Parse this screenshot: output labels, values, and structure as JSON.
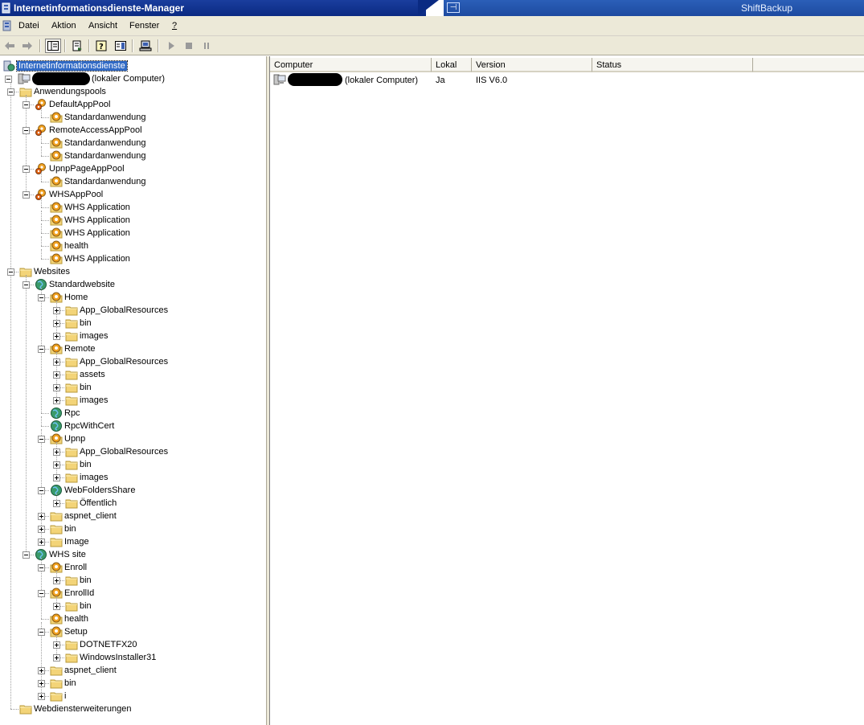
{
  "window": {
    "title": "Internetinformationsdienste-Manager",
    "right_window_title": "ShiftBackup",
    "pin_glyph": "⊣"
  },
  "menu": [
    "Datei",
    "Aktion",
    "Ansicht",
    "Fenster",
    "?"
  ],
  "toolbar": {
    "buttons": [
      "back-arrow-icon",
      "forward-arrow-icon",
      "show-hide-tree-icon",
      "export-list-icon",
      "help-icon",
      "properties-icon",
      "connect-computer-icon",
      "play-icon",
      "stop-icon",
      "pause-icon"
    ]
  },
  "tree": [
    {
      "label": "Internetinformationsdienste",
      "depth": 0,
      "icon": "iis-root-icon",
      "toggle": "none",
      "selected": true
    },
    {
      "label": "(lokaler Computer)",
      "depth": 0,
      "icon": "computer-icon",
      "toggle": "minus",
      "redacted": true
    },
    {
      "label": "Anwendungspools",
      "depth": 1,
      "icon": "folder-icon",
      "toggle": "minus"
    },
    {
      "label": "DefaultAppPool",
      "depth": 2,
      "icon": "app-pool-icon",
      "toggle": "minus"
    },
    {
      "label": "Standardanwendung",
      "depth": 3,
      "icon": "application-icon",
      "toggle": "none"
    },
    {
      "label": "RemoteAccessAppPool",
      "depth": 2,
      "icon": "app-pool-icon",
      "toggle": "minus"
    },
    {
      "label": "Standardanwendung",
      "depth": 3,
      "icon": "application-icon",
      "toggle": "none"
    },
    {
      "label": "Standardanwendung",
      "depth": 3,
      "icon": "application-icon",
      "toggle": "none"
    },
    {
      "label": "UpnpPageAppPool",
      "depth": 2,
      "icon": "app-pool-icon",
      "toggle": "minus"
    },
    {
      "label": "Standardanwendung",
      "depth": 3,
      "icon": "application-icon",
      "toggle": "none"
    },
    {
      "label": "WHSAppPool",
      "depth": 2,
      "icon": "app-pool-icon",
      "toggle": "minus"
    },
    {
      "label": "WHS Application",
      "depth": 3,
      "icon": "application-icon",
      "toggle": "none"
    },
    {
      "label": "WHS Application",
      "depth": 3,
      "icon": "application-icon",
      "toggle": "none"
    },
    {
      "label": "WHS Application",
      "depth": 3,
      "icon": "application-icon",
      "toggle": "none"
    },
    {
      "label": "health",
      "depth": 3,
      "icon": "application-icon",
      "toggle": "none"
    },
    {
      "label": "WHS Application",
      "depth": 3,
      "icon": "application-icon",
      "toggle": "none"
    },
    {
      "label": "Websites",
      "depth": 1,
      "icon": "folder-icon",
      "toggle": "minus"
    },
    {
      "label": "Standardwebsite",
      "depth": 2,
      "icon": "globe-icon",
      "toggle": "minus"
    },
    {
      "label": "Home",
      "depth": 3,
      "icon": "application-icon",
      "toggle": "minus"
    },
    {
      "label": "App_GlobalResources",
      "depth": 4,
      "icon": "folder-icon",
      "toggle": "plus"
    },
    {
      "label": "bin",
      "depth": 4,
      "icon": "folder-icon",
      "toggle": "plus"
    },
    {
      "label": "images",
      "depth": 4,
      "icon": "folder-icon",
      "toggle": "plus"
    },
    {
      "label": "Remote",
      "depth": 3,
      "icon": "application-icon",
      "toggle": "minus"
    },
    {
      "label": "App_GlobalResources",
      "depth": 4,
      "icon": "folder-icon",
      "toggle": "plus"
    },
    {
      "label": "assets",
      "depth": 4,
      "icon": "folder-icon",
      "toggle": "plus"
    },
    {
      "label": "bin",
      "depth": 4,
      "icon": "folder-icon",
      "toggle": "plus"
    },
    {
      "label": "images",
      "depth": 4,
      "icon": "folder-icon",
      "toggle": "plus"
    },
    {
      "label": "Rpc",
      "depth": 3,
      "icon": "globe-icon",
      "toggle": "none"
    },
    {
      "label": "RpcWithCert",
      "depth": 3,
      "icon": "globe-icon",
      "toggle": "none"
    },
    {
      "label": "Upnp",
      "depth": 3,
      "icon": "application-icon",
      "toggle": "minus"
    },
    {
      "label": "App_GlobalResources",
      "depth": 4,
      "icon": "folder-icon",
      "toggle": "plus"
    },
    {
      "label": "bin",
      "depth": 4,
      "icon": "folder-icon",
      "toggle": "plus"
    },
    {
      "label": "images",
      "depth": 4,
      "icon": "folder-icon",
      "toggle": "plus"
    },
    {
      "label": "WebFoldersShare",
      "depth": 3,
      "icon": "globe-icon",
      "toggle": "minus"
    },
    {
      "label": "Öffentlich",
      "depth": 4,
      "icon": "folder-icon",
      "toggle": "plus"
    },
    {
      "label": "aspnet_client",
      "depth": 3,
      "icon": "folder-icon",
      "toggle": "plus"
    },
    {
      "label": "bin",
      "depth": 3,
      "icon": "folder-icon",
      "toggle": "plus"
    },
    {
      "label": "Image",
      "depth": 3,
      "icon": "folder-icon",
      "toggle": "plus"
    },
    {
      "label": "WHS site",
      "depth": 2,
      "icon": "globe-icon",
      "toggle": "minus"
    },
    {
      "label": "Enroll",
      "depth": 3,
      "icon": "application-icon",
      "toggle": "minus"
    },
    {
      "label": "bin",
      "depth": 4,
      "icon": "folder-icon",
      "toggle": "plus"
    },
    {
      "label": "EnrollId",
      "depth": 3,
      "icon": "application-icon",
      "toggle": "minus"
    },
    {
      "label": "bin",
      "depth": 4,
      "icon": "folder-icon",
      "toggle": "plus"
    },
    {
      "label": "health",
      "depth": 3,
      "icon": "application-icon",
      "toggle": "none"
    },
    {
      "label": "Setup",
      "depth": 3,
      "icon": "application-icon",
      "toggle": "minus"
    },
    {
      "label": "DOTNETFX20",
      "depth": 4,
      "icon": "folder-icon",
      "toggle": "plus"
    },
    {
      "label": "WindowsInstaller31",
      "depth": 4,
      "icon": "folder-icon",
      "toggle": "plus"
    },
    {
      "label": "aspnet_client",
      "depth": 3,
      "icon": "folder-icon",
      "toggle": "plus"
    },
    {
      "label": "bin",
      "depth": 3,
      "icon": "folder-icon",
      "toggle": "plus"
    },
    {
      "label": "i",
      "depth": 3,
      "icon": "folder-icon",
      "toggle": "plus"
    },
    {
      "label": "Webdiensterweiterungen",
      "depth": 1,
      "icon": "folder-icon",
      "toggle": "none"
    }
  ],
  "list": {
    "columns": [
      "Computer",
      "Lokal",
      "Version",
      "Status"
    ],
    "rows": [
      {
        "computer": "(lokaler Computer)",
        "lokal": "Ja",
        "version": "IIS V6.0",
        "status": ""
      }
    ]
  }
}
